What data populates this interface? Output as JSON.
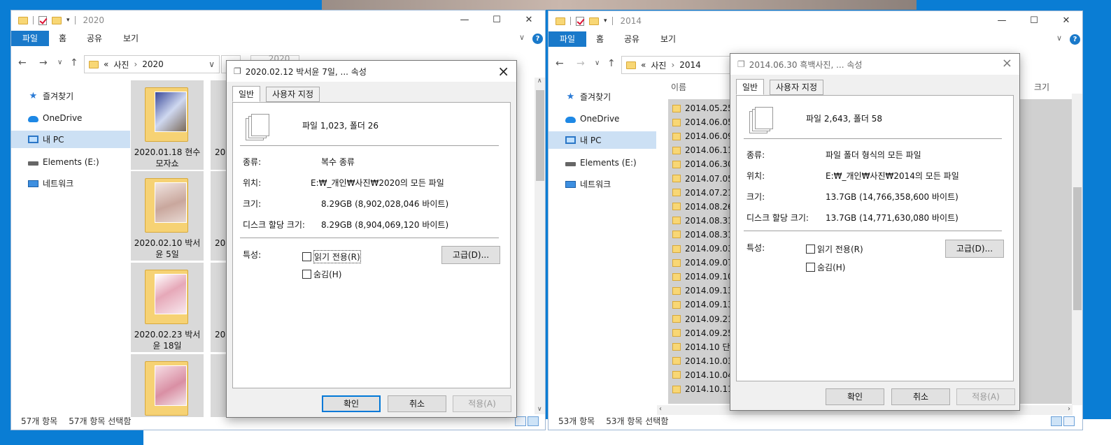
{
  "left": {
    "title": "2020",
    "ribbon_tabs": [
      "파일",
      "홈",
      "공유",
      "보기"
    ],
    "breadcrumb": [
      "«",
      "사진",
      "2020"
    ],
    "search_placeholder": "2020 검색",
    "nav": [
      "즐겨찾기",
      "OneDrive",
      "내 PC",
      "Elements (E:)",
      "네트워크"
    ],
    "folders": [
      {
        "caption": "2020.01.18 현수 모자쇼"
      },
      {
        "caption": "2020.02.10 박서 윤 5일"
      },
      {
        "caption": "2020.02.23 박서 윤 18일"
      },
      {
        "caption": ""
      }
    ],
    "partial_captions": [
      "20",
      "20",
      "20"
    ],
    "status_count": "57개 항목",
    "status_selected": "57개 항목 선택함"
  },
  "right": {
    "title": "2014",
    "ribbon_tabs": [
      "파일",
      "홈",
      "공유",
      "보기"
    ],
    "breadcrumb": [
      "«",
      "사진",
      "2014"
    ],
    "column_name": "이름",
    "column_size": "크기",
    "rows": [
      "2014.05.25",
      "2014.06.05",
      "2014.06.09",
      "2014.06.11",
      "2014.06.30",
      "2014.07.05",
      "2014.07.21",
      "2014.08.26",
      "2014.08.31",
      "2014.08.31",
      "2014.09.03",
      "2014.09.07",
      "2014.09.10",
      "2014.09.13",
      "2014.09.13",
      "2014.09.21",
      "2014.09.25",
      "2014.10 단양",
      "2014.10.03",
      "2014.10.04",
      "2014.10.11"
    ],
    "nav": [
      "즐겨찾기",
      "OneDrive",
      "내 PC",
      "Elements (E:)",
      "네트워크"
    ],
    "status_count": "53개 항목",
    "status_selected": "53개 항목 선택함"
  },
  "dialog1": {
    "title": "2020.02.12 박서윤 7일, ... 속성",
    "tabs": [
      "일반",
      "사용자 지정"
    ],
    "summary": "파일 1,023, 폴더 26",
    "type_label": "종류:",
    "type_value": "복수 종류",
    "location_label": "위치:",
    "location_value": "E:₩_개인₩사진₩2020의 모든 파일",
    "size_label": "크기:",
    "size_value": "8.29GB (8,902,028,046 바이트)",
    "disk_label": "디스크 할당 크기:",
    "disk_value": "8.29GB (8,904,069,120 바이트)",
    "attr_label": "특성:",
    "readonly": "읽기 전용(R)",
    "hidden": "숨김(H)",
    "advanced": "고급(D)...",
    "ok": "확인",
    "cancel": "취소",
    "apply": "적용(A)"
  },
  "dialog2": {
    "title": "2014.06.30 흑백사진, ... 속성",
    "tabs": [
      "일반",
      "사용자 지정"
    ],
    "summary": "파일 2,643, 폴더 58",
    "type_label": "종류:",
    "type_value": "파일 폴더 형식의 모든 파일",
    "location_label": "위치:",
    "location_value": "E:₩_개인₩사진₩2014의 모든 파일",
    "size_label": "크기:",
    "size_value": "13.7GB (14,766,358,600 바이트)",
    "disk_label": "디스크 할당 크기:",
    "disk_value": "13.7GB (14,771,630,080 바이트)",
    "attr_label": "특성:",
    "readonly": "읽기 전용(R)",
    "hidden": "숨김(H)",
    "advanced": "고급(D)...",
    "ok": "확인",
    "cancel": "취소",
    "apply": "적용(A)"
  },
  "colors": {
    "accent": "#1979ca",
    "desktop": "#0a7dd4",
    "selection": "#cce0f4"
  }
}
